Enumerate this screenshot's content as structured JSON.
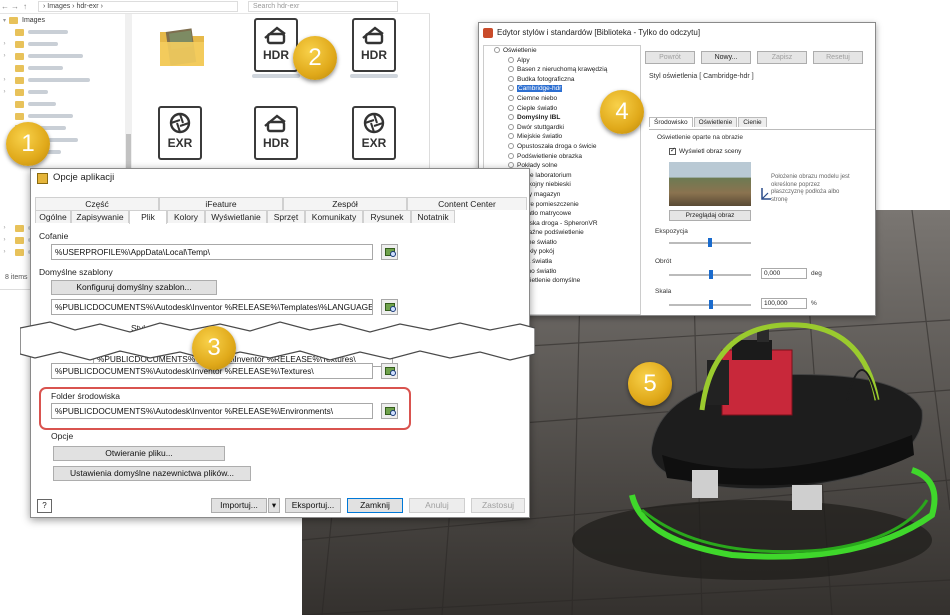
{
  "explorer": {
    "back": "←",
    "forward": "→",
    "up": "↑",
    "breadcrumb": "› Images › hdr-exr ›",
    "search_placeholder": "Search hdr-exr",
    "tree_root": "Images",
    "status": "8 items",
    "files": [
      {
        "ext": "HDR"
      },
      {
        "ext": "HDR"
      },
      {
        "ext": "EXR"
      },
      {
        "ext": "HDR"
      },
      {
        "ext": "EXR"
      }
    ]
  },
  "editor": {
    "title": "Edytor stylów i standardów [Biblioteka - Tylko do odczytu]",
    "tree_root": "Oświetlenie",
    "items": [
      "Alpy",
      "Basen z nieruchomą krawędzią",
      "Budka fotograficzna",
      "Cambridge-hdr",
      "Ciemne niebo",
      "Ciepłe światło",
      "Domyślny IBL",
      "Dwór stuttgardki",
      "Miejskie światło",
      "Opustoszała droga o świcie",
      "Podświetlenie obrazka",
      "Pokłady solne",
      "Poste laboratorium",
      "Spokojny niebieski",
      "Stary magazyn",
      "Szare pomieszczenie",
      "Światło matrycowe",
      "Wiejska droga - SpheronVR",
      "Wyraźne podświetlenie",
      "Zimne światło",
      "Zwykły pokój",
      "Owa światła",
      "Jedno światło",
      "Oświetlenie domyślne"
    ],
    "buttons": {
      "back": "Powrót",
      "new": "Nowy...",
      "save": "Zapisz",
      "reset": "Resetuj"
    },
    "style_label": "Styl oświetlenia [ Cambridge-hdr ]",
    "tabs": [
      "Środowisko",
      "Oświetlenie",
      "Cienie"
    ],
    "group_title": "Oświetlenie oparte na obrazie",
    "show_image_label": "Wyświetl obraz sceny",
    "browse_image": "Przeglądaj obraz",
    "exposure_label": "Ekspozycja",
    "rotation_label": "Obrót",
    "rotation_value": "0,000",
    "rotation_unit": "deg",
    "scale_label": "Skala",
    "scale_value": "100,000",
    "scale_unit": "%",
    "description": "Położenie obrazu modelu jest określone poprzez płaszczyznę podłoża albo stronę",
    "exposure_level": 0.5
  },
  "options": {
    "title": "Opcje aplikacji",
    "tabs_top": [
      "Część",
      "iFeature",
      "Zespół",
      "Content Center"
    ],
    "tabs_bottom": [
      "Ogólne",
      "Zapisywanie",
      "Plik",
      "Kolory",
      "Wyświetlanie",
      "Sprzęt",
      "Komunikaty",
      "Rysunek",
      "Notatnik"
    ],
    "undo_label": "Cofanie",
    "undo_path": "%USERPROFILE%\\AppData\\Local\\Temp\\",
    "templates_label": "Domyślne szablony",
    "configure_templates": "Konfiguruj domyślny szablon...",
    "templates_path": "%PUBLICDOCUMENTS%\\Autodesk\\Inventor %RELEASE%\\Templates\\%LANGUAGE%\\",
    "styles_label_partial": "Style",
    "textures_path_a": "%PUBLICDOCUMENTS%\\Autodesk\\Inventor %RELEASE%\\Textures\\",
    "textures_path_b": "%PUBLICDOCUMENTS%\\Autodesk\\Inventor %RELEASE%\\Textures\\",
    "env_label": "Folder środowiska",
    "env_path": "%PUBLICDOCUMENTS%\\Autodesk\\Inventor %RELEASE%\\Environments\\",
    "options_label": "Opcje",
    "open_file": "Otwieranie pliku...",
    "naming": "Ustawienia domyślne nazewnictwa plików...",
    "import": "Importuj...",
    "export": "Eksportuj...",
    "close": "Zamknij",
    "cancel": "Anuluj",
    "apply": "Zastosuj",
    "help": "?"
  },
  "badges": [
    "1",
    "2",
    "3",
    "4",
    "5"
  ]
}
